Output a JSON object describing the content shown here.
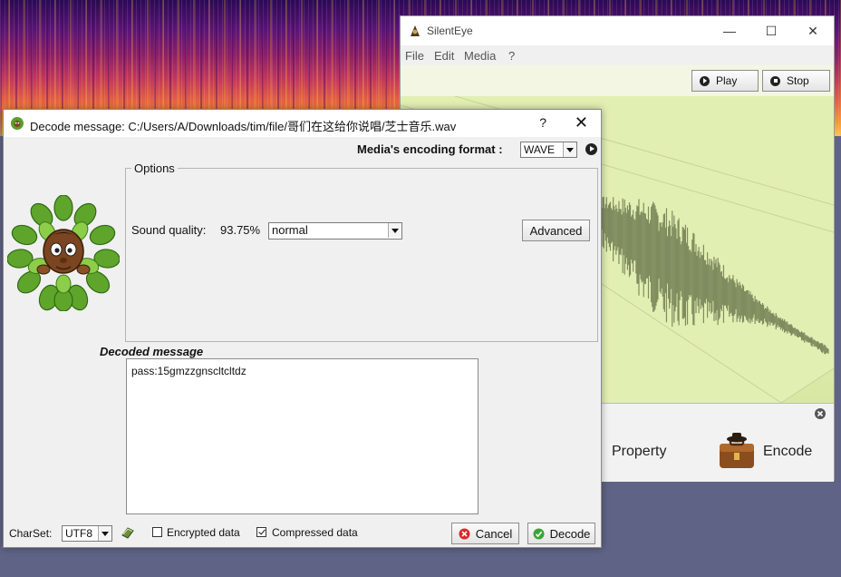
{
  "main_window": {
    "title": "SilentEye",
    "menu": [
      "File",
      "Edit",
      "Media",
      "?"
    ],
    "play_label": "Play",
    "stop_label": "Stop",
    "property_label": "Property",
    "encode_label": "Encode"
  },
  "dialog": {
    "title": "Decode message: C:/Users/A/Downloads/tim/file/哥们在这给你说唱/芝士音乐.wav",
    "help_label": "?",
    "format_label": "Media's encoding format :",
    "format_value": "WAVE",
    "options_legend": "Options",
    "sound_quality_label": "Sound quality:",
    "sound_quality_value": "93.75%",
    "quality_mode": "normal",
    "advanced_label": "Advanced",
    "decoded_label": "Decoded message",
    "decoded_text": "pass:15gmzzgnscltcltdz",
    "charset_label": "CharSet:",
    "charset_value": "UTF8",
    "encrypted_label": "Encrypted data",
    "encrypted_checked": false,
    "compressed_label": "Compressed data",
    "compressed_checked": true,
    "cancel_label": "Cancel",
    "decode_label": "Decode"
  },
  "colors": {
    "wave_bg": "#e5f1b9",
    "wave_stroke": "#7f8c5f",
    "desktop": "#5f6385"
  }
}
